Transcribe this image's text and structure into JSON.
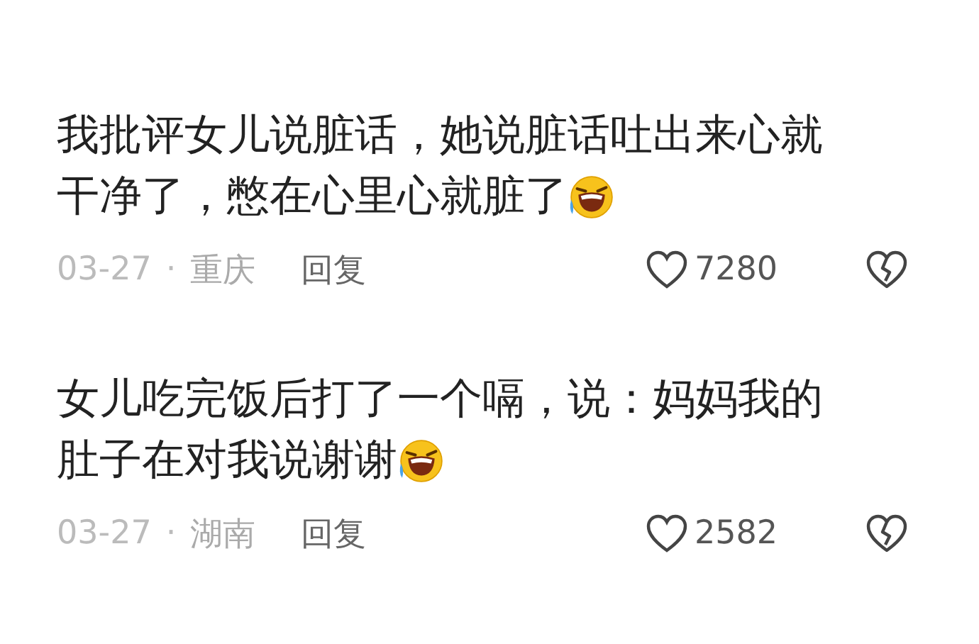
{
  "comments": [
    {
      "lines": [
        "我批评女儿说脏话，她说脏话吐出来心就",
        "干净了，憋在心里心就脏了"
      ],
      "date": "03-27",
      "separator": "·",
      "location": "重庆",
      "reply": "回复",
      "likes": "7280"
    },
    {
      "lines": [
        "女儿吃完饭后打了一个嗝，说：妈妈我的",
        "肚子在对我说谢谢"
      ],
      "date": "03-27",
      "separator": "·",
      "location": "湖南",
      "reply": "回复",
      "likes": "2582"
    }
  ]
}
